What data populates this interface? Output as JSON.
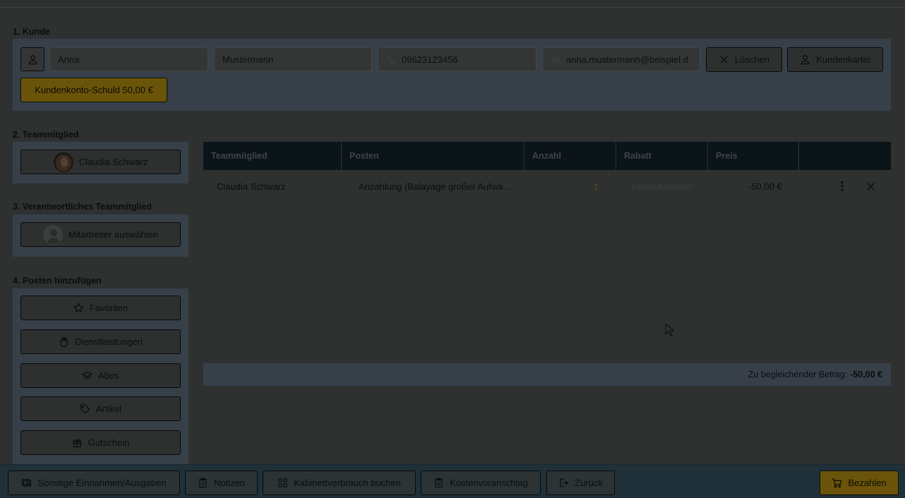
{
  "section1": {
    "title": "1. Kunde",
    "first_name": "Anna",
    "last_name": "Mustermann",
    "phone": "09623123456",
    "email": "anna.mustermann@beispiel.d",
    "delete_label": "Löschen",
    "customer_card_label": "Kundenkartei",
    "debt_label": "Kundenkonto-Schuld 50,00 €"
  },
  "section2": {
    "title": "2. Teammitglied",
    "member": "Claudia Schwarz"
  },
  "section3": {
    "title": "3. Verantwortliches Teammitglied",
    "select_label": "Mitarbeiter auswählen"
  },
  "section4": {
    "title": "4. Posten hinzufügen",
    "items": [
      "Favoriten",
      "Dienstleistungen",
      "Abos",
      "Artikel",
      "Gutschein"
    ]
  },
  "table": {
    "headers": [
      "Teammitglied",
      "Posten",
      "Anzahl",
      "Rabatt",
      "Preis",
      ""
    ],
    "rows": [
      {
        "member": "Claudia Schwarz",
        "item": "Anzahlung (Balayage großer Aufwa...",
        "qty": "1",
        "discount": "Keine Auswahl",
        "price": "-50,00 €"
      }
    ]
  },
  "total": {
    "label": "Zu begleichender Betrag:",
    "amount": "-50,00 €"
  },
  "footer": {
    "other": "Sonstige Einnahmen/Ausgaben",
    "notes": "Notizen",
    "cabinet": "Kabinettverbrauch buchen",
    "estimate": "Kostenvoranschlag",
    "back": "Zurück",
    "pay": "Bezahlen"
  },
  "colors": {
    "accent_gold": "#6a5409",
    "panel_blue": "#374049",
    "table_header": "#0b1418",
    "qty_color": "#5b4a0c"
  }
}
